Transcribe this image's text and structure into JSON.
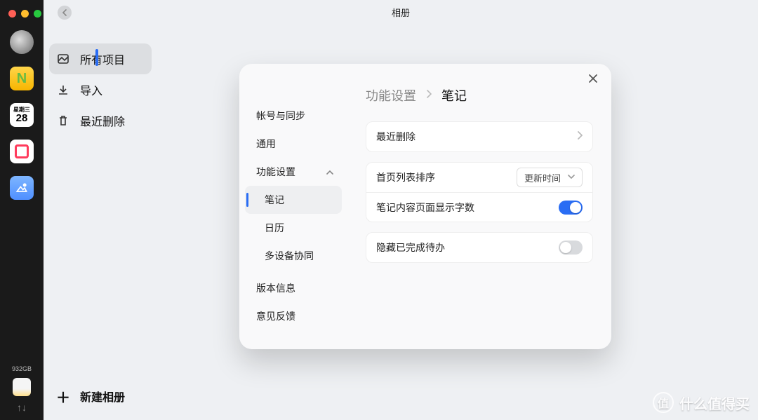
{
  "dock": {
    "calendar_label": "星期三",
    "calendar_day": "28",
    "storage_text": "932GB",
    "arrows": "↑↓"
  },
  "window": {
    "title": "相册"
  },
  "album_sidebar": {
    "items": [
      {
        "label": "所有项目"
      },
      {
        "label": "导入"
      },
      {
        "label": "最近删除"
      }
    ],
    "new_album": "新建相册"
  },
  "modal": {
    "breadcrumb_parent": "功能设置",
    "breadcrumb_current": "笔记",
    "side": {
      "account_sync": "帐号与同步",
      "general": "通用",
      "features": "功能设置",
      "notes": "笔记",
      "calendar": "日历",
      "multi_device": "多设备协同",
      "version": "版本信息",
      "feedback": "意见反馈"
    },
    "rows": {
      "recent_delete": "最近删除",
      "homepage_sort": "首页列表排序",
      "homepage_sort_value": "更新时间",
      "show_char_count": "笔记内容页面显示字数",
      "hide_done_todos": "隐藏已完成待办"
    }
  },
  "watermark": "什么值得买"
}
